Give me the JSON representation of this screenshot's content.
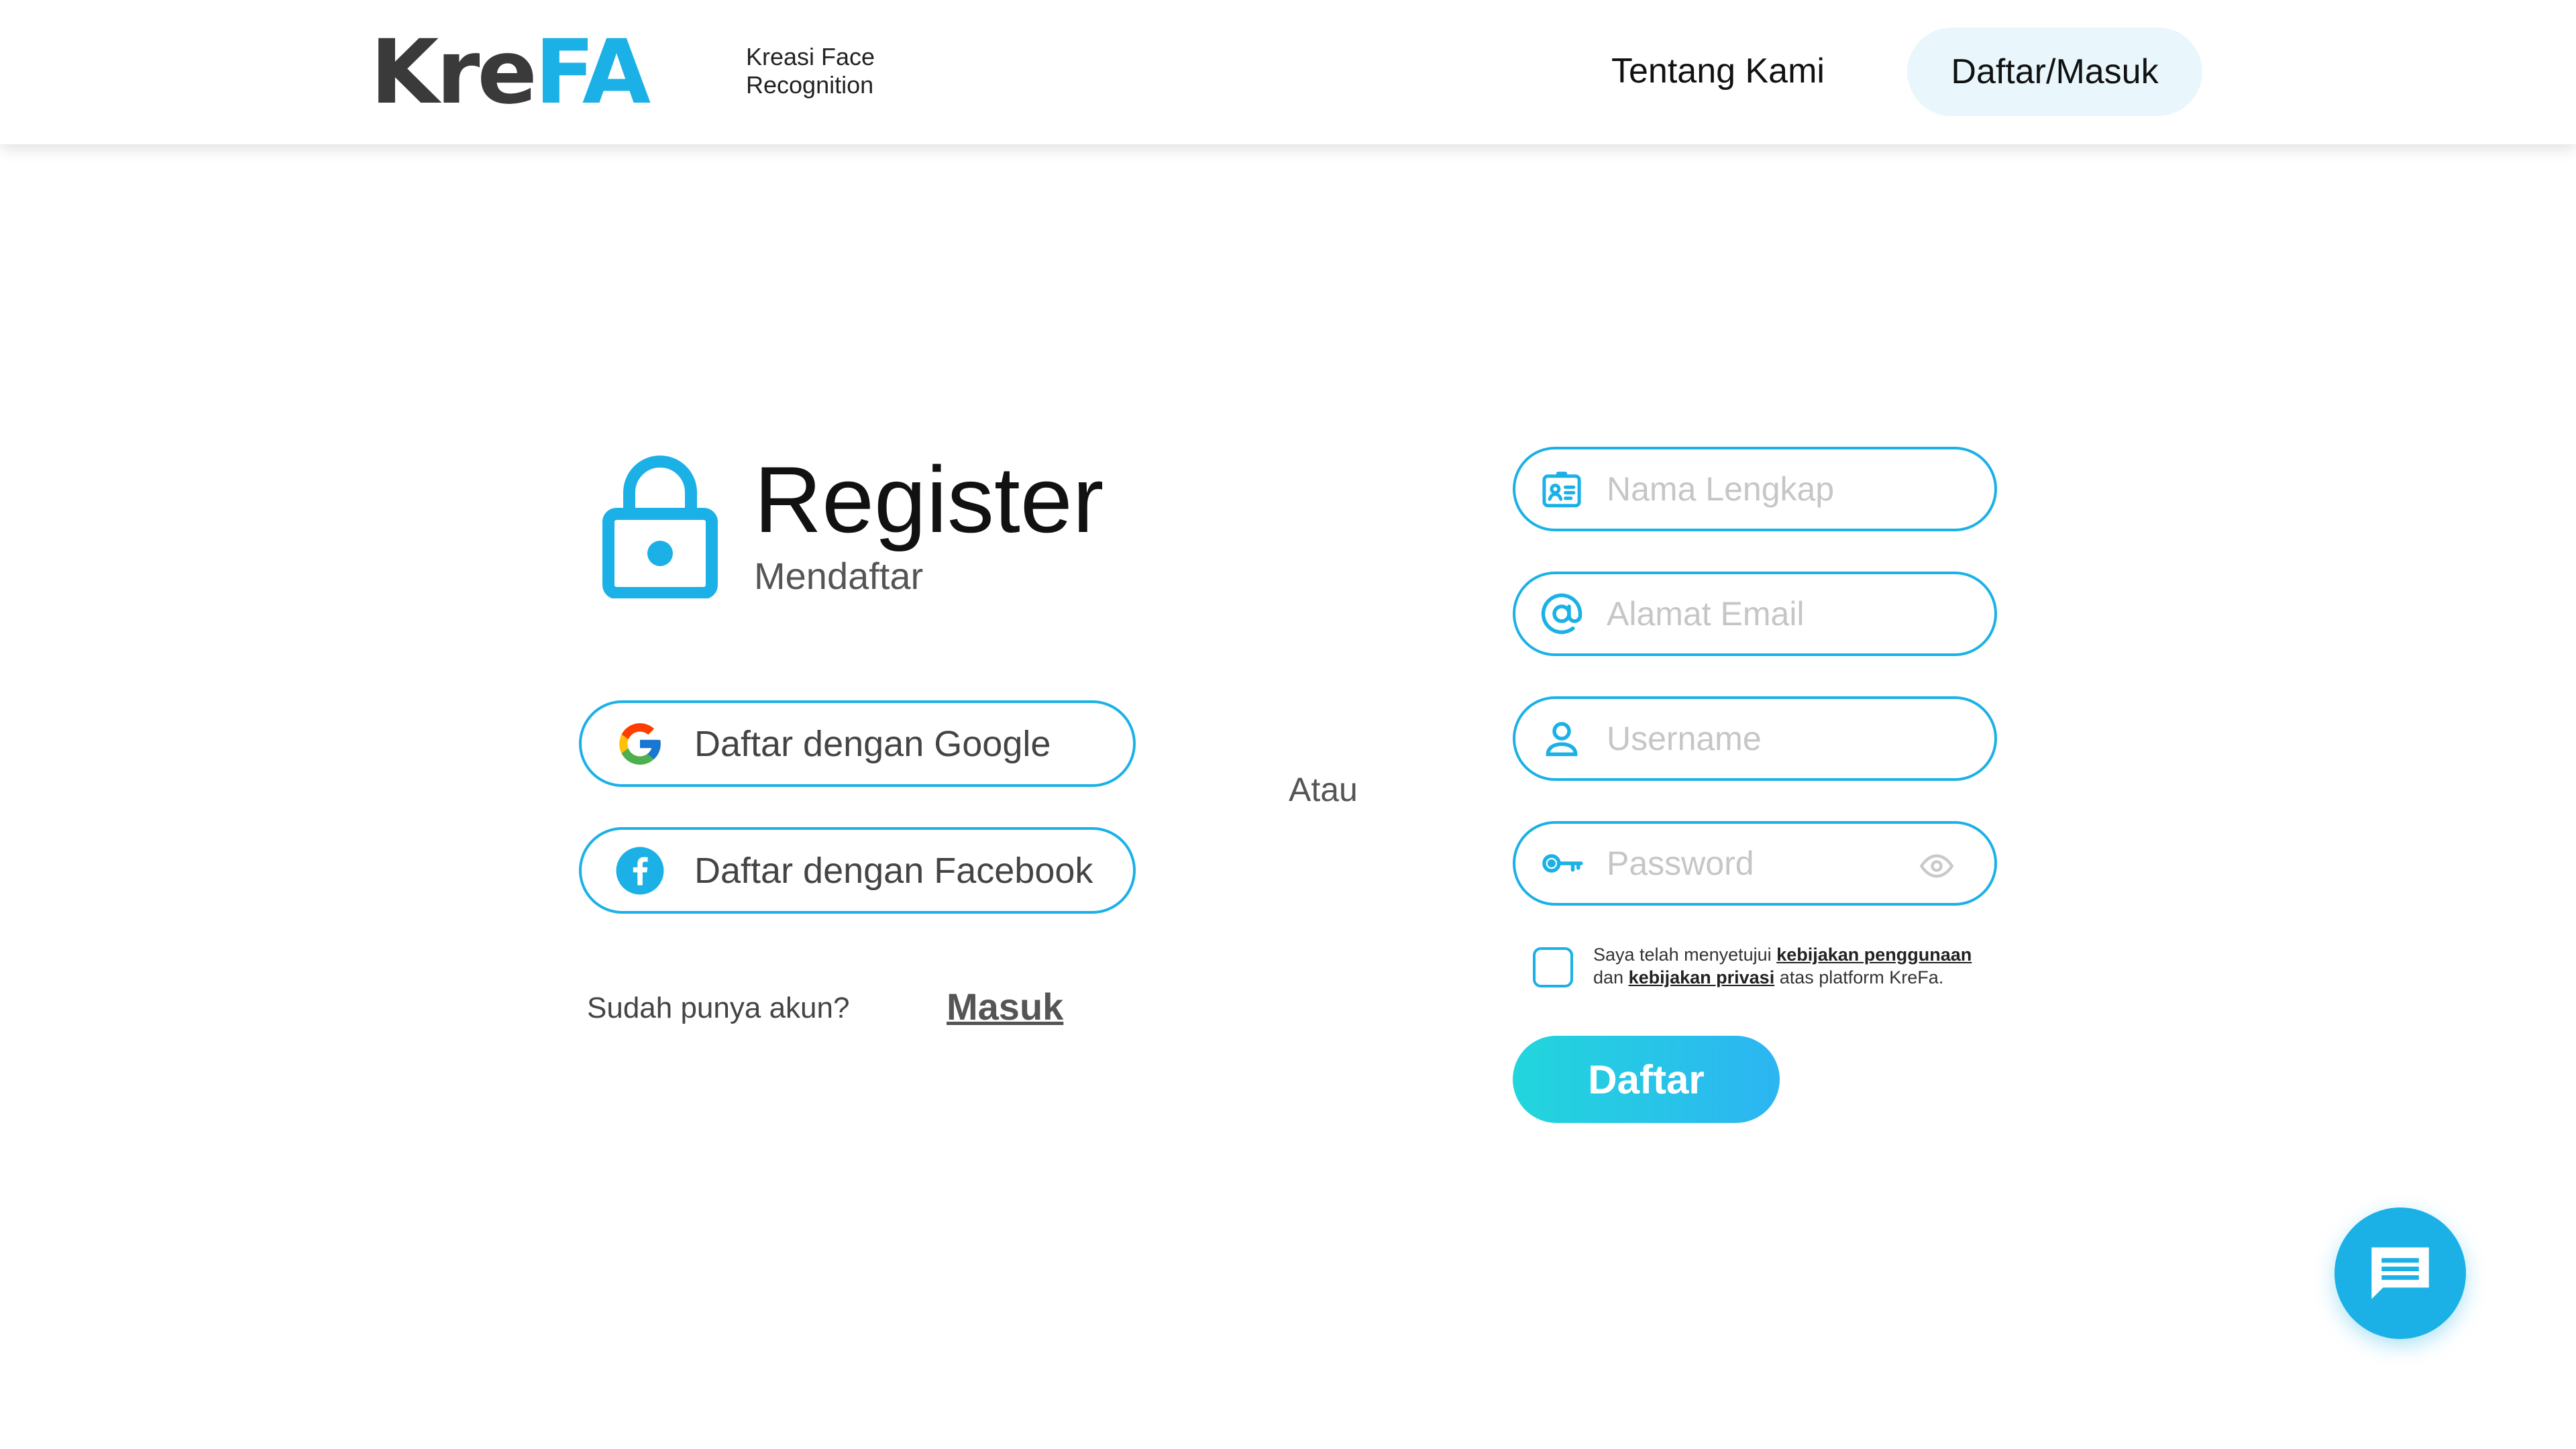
{
  "header": {
    "logo_part1": "Kre",
    "logo_part2": "FA",
    "tagline_line1": "Kreasi Face",
    "tagline_line2": "Recognition",
    "nav_about": "Tentang Kami",
    "nav_auth": "Daftar/Masuk"
  },
  "register": {
    "title": "Register",
    "subtitle": "Mendaftar",
    "google_label": "Daftar dengan Google",
    "facebook_label": "Daftar dengan Facebook",
    "have_account": "Sudah punya akun?",
    "login_link": "Masuk",
    "or": "Atau"
  },
  "form": {
    "name_placeholder": "Nama Lengkap",
    "email_placeholder": "Alamat Email",
    "username_placeholder": "Username",
    "password_placeholder": "Password",
    "agree_text1": "Saya telah menyetujui",
    "agree_link1": "kebijakan penggunaan",
    "agree_text2": "dan",
    "agree_link2": "kebijakan privasi",
    "agree_text3": "atas platform KreFa.",
    "submit": "Daftar"
  },
  "icons": {
    "lock": "lock-icon",
    "google": "google-icon",
    "facebook": "facebook-icon",
    "id_card": "id-card-icon",
    "at": "at-sign-icon",
    "user": "user-icon",
    "key": "key-icon",
    "eye": "eye-icon",
    "chat": "chat-icon"
  },
  "colors": {
    "accent": "#1bb1e6",
    "logo_dark": "#3a3a3a",
    "gradient_start": "#22d6dc",
    "gradient_end": "#2cb5f2",
    "nav_pill_bg": "#e9f7fd"
  }
}
